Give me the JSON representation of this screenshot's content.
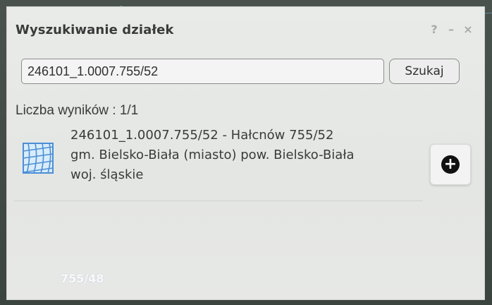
{
  "panel": {
    "title": "Wyszukiwanie działek",
    "controls": {
      "help": "?",
      "minimize": "–",
      "close": "×"
    }
  },
  "search": {
    "value": "246101_1.0007.755/52",
    "button_label": "Szukaj"
  },
  "results": {
    "count_text": "Liczba wyników : 1/1",
    "items": [
      {
        "line1": "246101_1.0007.755/52 - Hałcnów 755/52",
        "line2": "gm. Bielsko-Biała (miasto) pow. Bielsko-Biała",
        "line3": "woj. śląskie",
        "icon": "parcel-map-icon",
        "action_icon": "plus-circle-icon"
      }
    ]
  },
  "map": {
    "label": "755/48"
  },
  "colors": {
    "panel_bg": "#e7e9e7",
    "text": "#3a3a3a",
    "icon_blue": "#4a8fd6",
    "accent_black": "#111111"
  }
}
